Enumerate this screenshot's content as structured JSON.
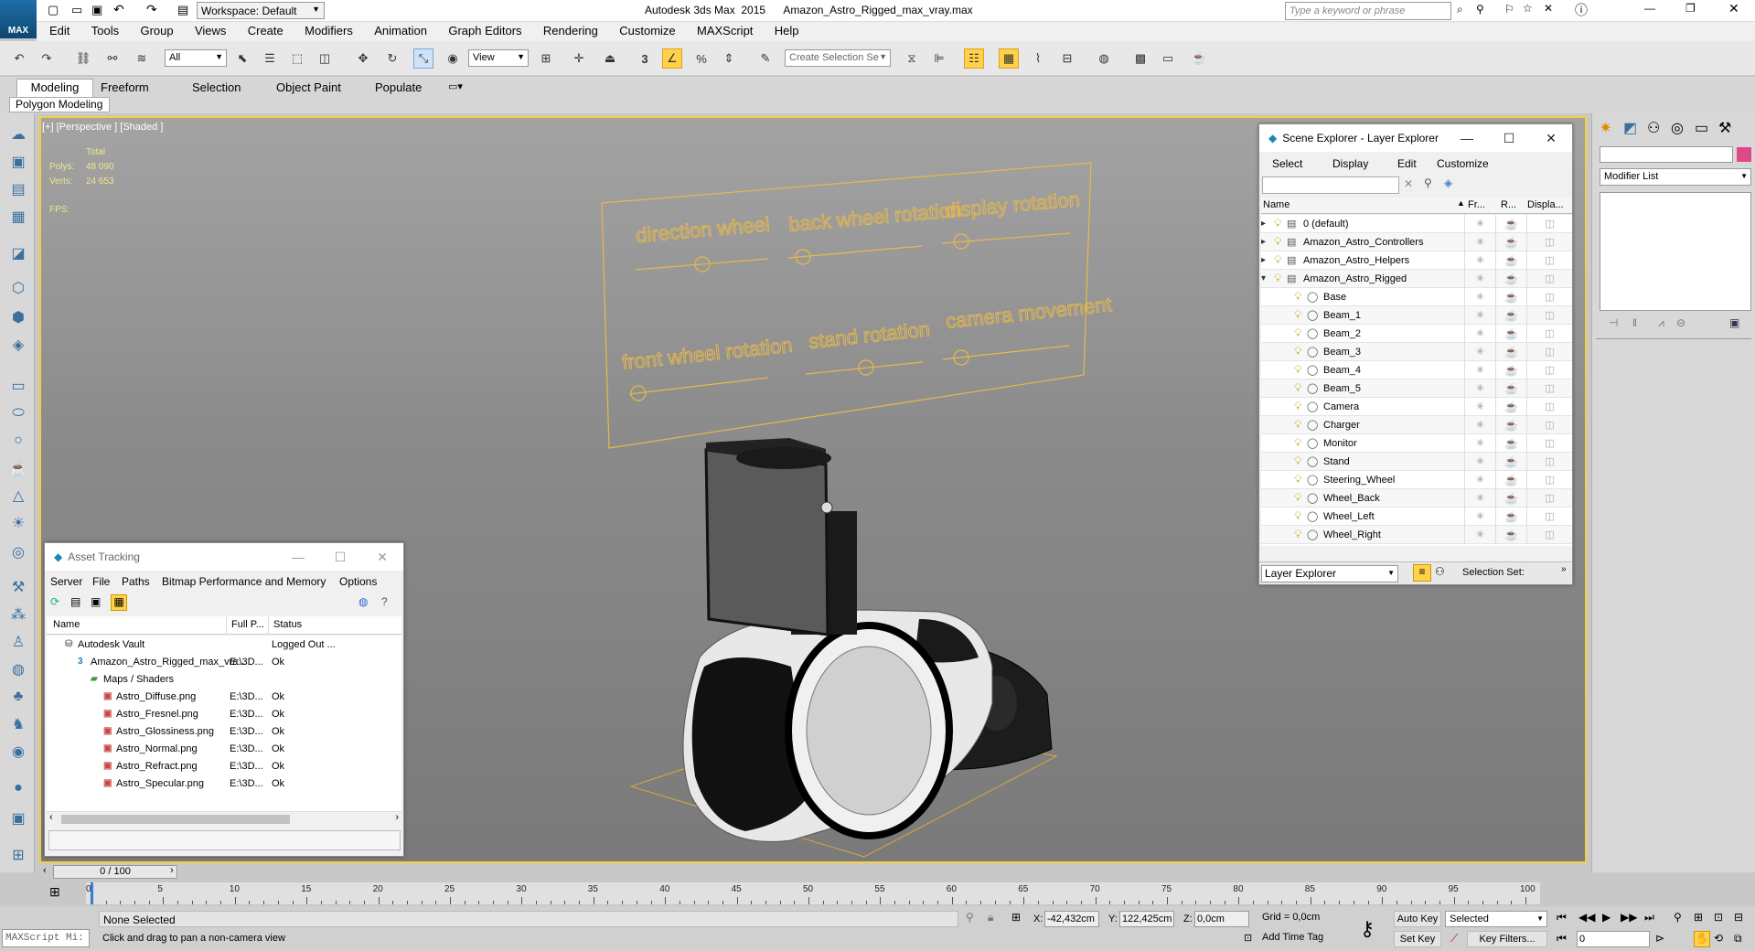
{
  "app": {
    "title": "Autodesk 3ds Max  2015      Amazon_Astro_Rigged_max_vray.max",
    "logo": "MAX",
    "workspace": "Workspace: Default",
    "search_placeholder": "Type a keyword or phrase"
  },
  "menu": [
    "Edit",
    "Tools",
    "Group",
    "Views",
    "Create",
    "Modifiers",
    "Animation",
    "Graph Editors",
    "Rendering",
    "Customize",
    "MAXScript",
    "Help"
  ],
  "toolbar": {
    "filter": "All",
    "ref_coord": "View",
    "named_sel": "Create Selection Se",
    "snap_label": "3"
  },
  "ribbon": {
    "tabs": [
      "Modeling",
      "Freeform",
      "Selection",
      "Object Paint",
      "Populate"
    ],
    "sub": "Polygon Modeling"
  },
  "viewport": {
    "label": "[+] [Perspective ] [Shaded ]",
    "stats_header": "Total",
    "polys_label": "Polys:",
    "polys": "48 090",
    "verts_label": "Verts:",
    "verts": "24 653",
    "fps_label": "FPS:",
    "rig_labels": [
      "direction wheel",
      "back wheel rotation",
      "display rotation",
      "front wheel rotation",
      "stand rotation",
      "camera movement"
    ]
  },
  "scene_explorer": {
    "title": "Scene Explorer - Layer Explorer",
    "menu": [
      "Select",
      "Display",
      "Edit",
      "Customize"
    ],
    "columns": [
      "Name",
      "Fr...",
      "R...",
      "Displa..."
    ],
    "layers": [
      {
        "name": "0 (default)",
        "level": 0,
        "arrow": "▸",
        "type": "layer"
      },
      {
        "name": "Amazon_Astro_Controllers",
        "level": 0,
        "arrow": "▸",
        "type": "layer"
      },
      {
        "name": "Amazon_Astro_Helpers",
        "level": 0,
        "arrow": "▸",
        "type": "layer"
      },
      {
        "name": "Amazon_Astro_Rigged",
        "level": 0,
        "arrow": "▾",
        "type": "layer"
      },
      {
        "name": "Base",
        "level": 1,
        "arrow": "",
        "type": "object"
      },
      {
        "name": "Beam_1",
        "level": 1,
        "arrow": "",
        "type": "object"
      },
      {
        "name": "Beam_2",
        "level": 1,
        "arrow": "",
        "type": "object"
      },
      {
        "name": "Beam_3",
        "level": 1,
        "arrow": "",
        "type": "object"
      },
      {
        "name": "Beam_4",
        "level": 1,
        "arrow": "",
        "type": "object"
      },
      {
        "name": "Beam_5",
        "level": 1,
        "arrow": "",
        "type": "object"
      },
      {
        "name": "Camera",
        "level": 1,
        "arrow": "",
        "type": "object"
      },
      {
        "name": "Charger",
        "level": 1,
        "arrow": "",
        "type": "object"
      },
      {
        "name": "Monitor",
        "level": 1,
        "arrow": "",
        "type": "object"
      },
      {
        "name": "Stand",
        "level": 1,
        "arrow": "",
        "type": "object"
      },
      {
        "name": "Steering_Wheel",
        "level": 1,
        "arrow": "",
        "type": "object"
      },
      {
        "name": "Wheel_Back",
        "level": 1,
        "arrow": "",
        "type": "object"
      },
      {
        "name": "Wheel_Left",
        "level": 1,
        "arrow": "",
        "type": "object"
      },
      {
        "name": "Wheel_Right",
        "level": 1,
        "arrow": "",
        "type": "object"
      }
    ],
    "footer_select": "Layer Explorer",
    "selection_set_label": "Selection Set:"
  },
  "asset_tracking": {
    "title": "Asset Tracking",
    "menu": [
      "Server",
      "File",
      "Paths",
      "Bitmap Performance and Memory",
      "Options"
    ],
    "columns": [
      "Name",
      "Full P...",
      "Status"
    ],
    "rows": [
      {
        "name": "Autodesk Vault",
        "path": "",
        "status": "Logged Out ...",
        "level": 0,
        "kind": "vault"
      },
      {
        "name": "Amazon_Astro_Rigged_max_vra...",
        "path": "E:\\3D...",
        "status": "Ok",
        "level": 1,
        "kind": "max"
      },
      {
        "name": "Maps / Shaders",
        "path": "",
        "status": "",
        "level": 2,
        "kind": "folder"
      },
      {
        "name": "Astro_Diffuse.png",
        "path": "E:\\3D...",
        "status": "Ok",
        "level": 3,
        "kind": "png"
      },
      {
        "name": "Astro_Fresnel.png",
        "path": "E:\\3D...",
        "status": "Ok",
        "level": 3,
        "kind": "png"
      },
      {
        "name": "Astro_Glossiness.png",
        "path": "E:\\3D...",
        "status": "Ok",
        "level": 3,
        "kind": "png"
      },
      {
        "name": "Astro_Normal.png",
        "path": "E:\\3D...",
        "status": "Ok",
        "level": 3,
        "kind": "png"
      },
      {
        "name": "Astro_Refract.png",
        "path": "E:\\3D...",
        "status": "Ok",
        "level": 3,
        "kind": "png"
      },
      {
        "name": "Astro_Specular.png",
        "path": "E:\\3D...",
        "status": "Ok",
        "level": 3,
        "kind": "png"
      }
    ]
  },
  "command_panel": {
    "modifier_list": "Modifier List"
  },
  "timeline": {
    "frame": "0 / 100",
    "ticks": [
      "0",
      "5",
      "10",
      "15",
      "20",
      "25",
      "30",
      "35",
      "40",
      "45",
      "50",
      "55",
      "60",
      "65",
      "70",
      "75",
      "80",
      "85",
      "90",
      "95",
      "100"
    ]
  },
  "status": {
    "maxscript": "MAXScript Mi:",
    "selection": "None Selected",
    "prompt": "Click and drag to pan a non-camera view",
    "x_label": "X:",
    "x": "-42,432cm",
    "y_label": "Y:",
    "y": "122,425cm",
    "z_label": "Z:",
    "z": "0,0cm",
    "grid": "Grid = 0,0cm",
    "add_time_tag": "Add Time Tag",
    "auto_key": "Auto Key",
    "set_key": "Set Key",
    "key_mode": "Selected",
    "key_filters": "Key Filters...",
    "frame_field": "0"
  },
  "colors": {
    "viewport_border": "#f4d03f",
    "rig_lines": "#e8b94a",
    "stats_text": "#f0e68c"
  }
}
